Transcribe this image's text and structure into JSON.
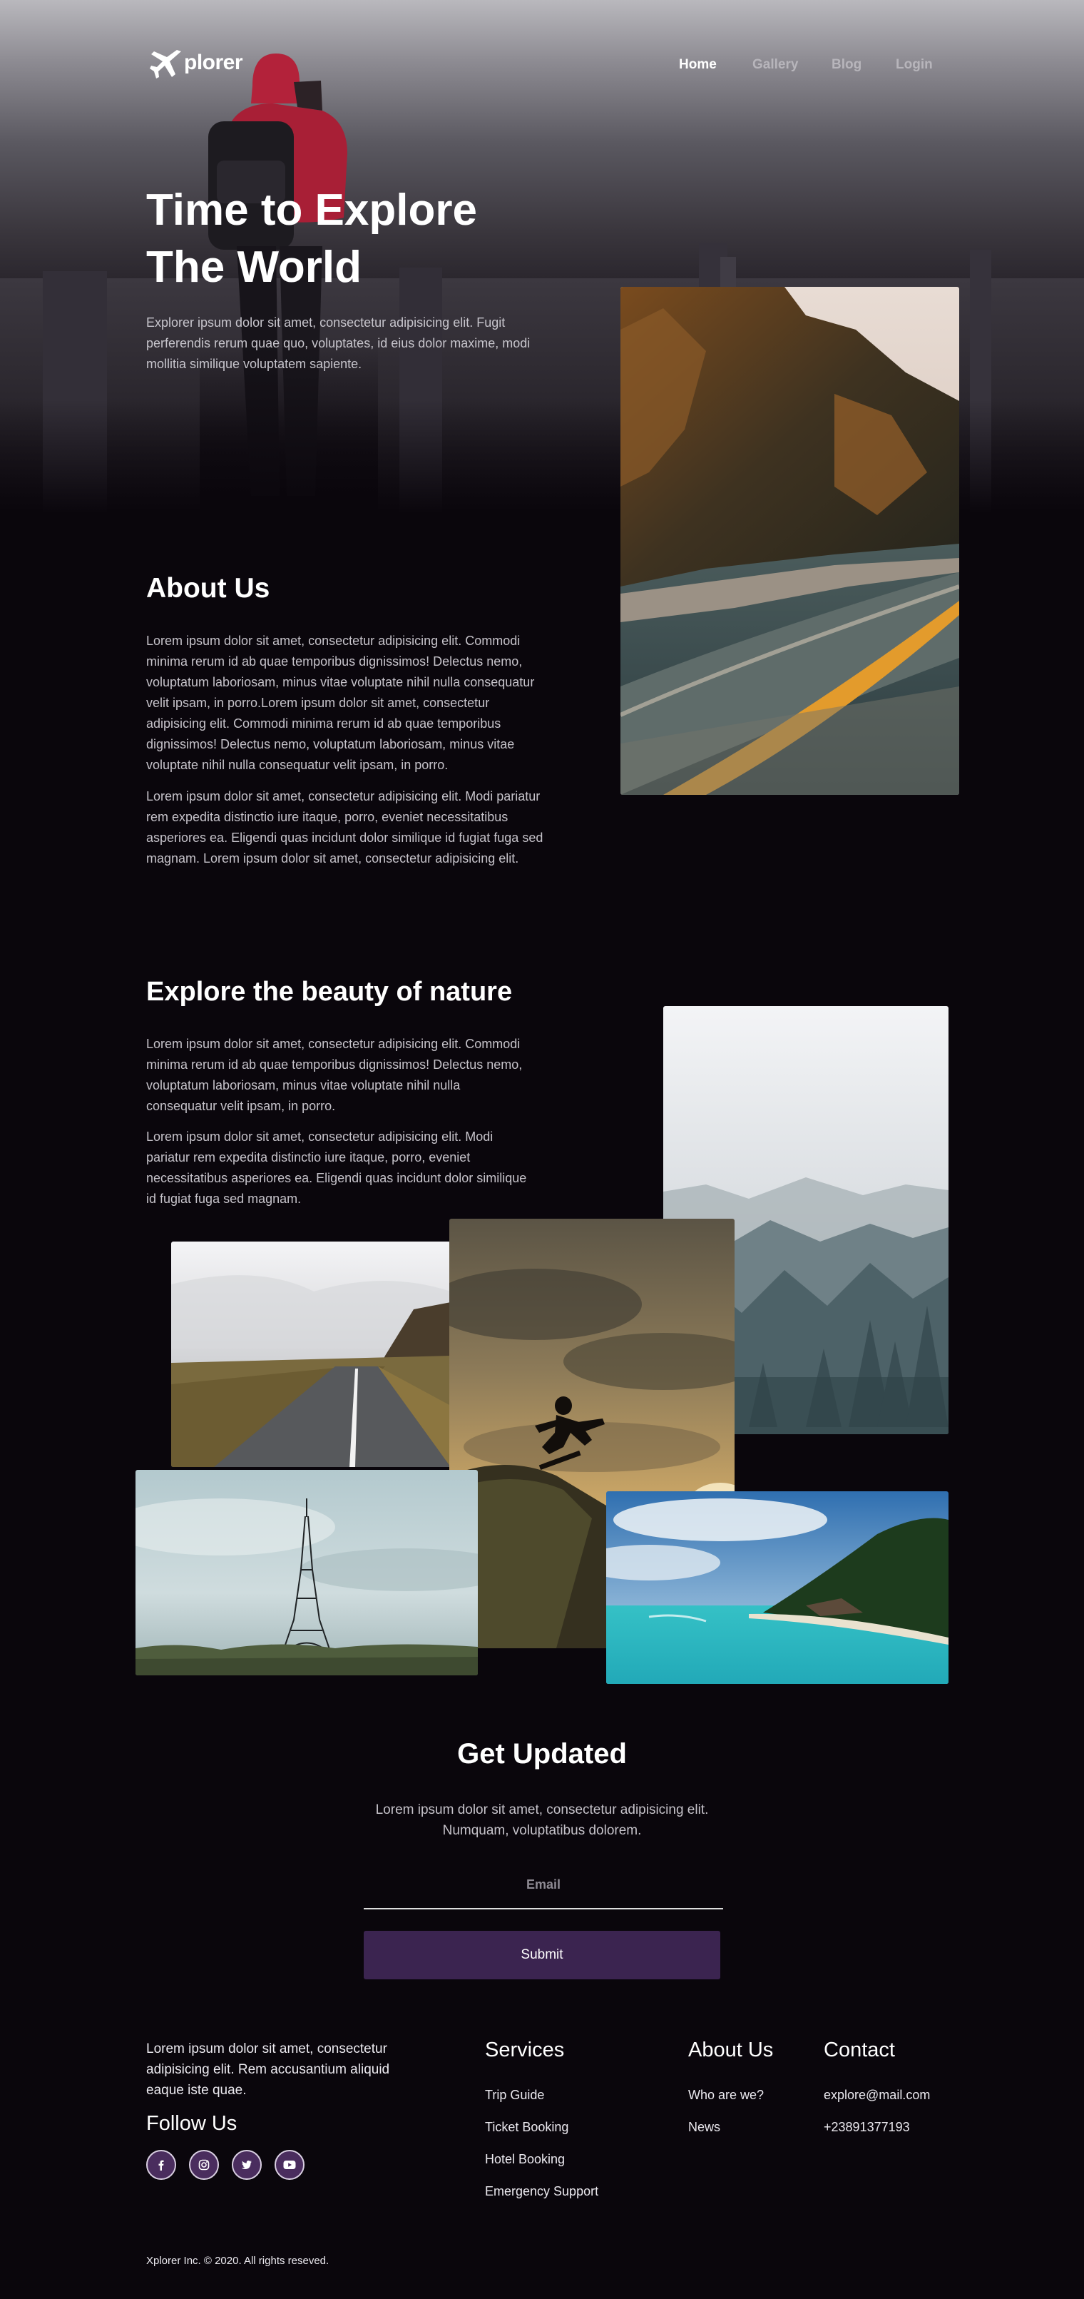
{
  "nav": {
    "logo_text": "plorer",
    "items": [
      {
        "label": "Home",
        "active": true
      },
      {
        "label": "Gallery",
        "active": false
      },
      {
        "label": "Blog",
        "active": false
      },
      {
        "label": "Login",
        "active": false
      }
    ]
  },
  "hero": {
    "title_line1": "Time to Explore",
    "title_line2": "The World",
    "text": "Explorer ipsum dolor sit amet, consectetur adipisicing elit. Fugit perferendis rerum quae quo, voluptates, id eius dolor maxime, modi mollitia similique voluptatem sapiente."
  },
  "about": {
    "title": "About Us",
    "para1": "Lorem ipsum dolor sit amet, consectetur adipisicing elit. Commodi minima rerum id ab quae temporibus dignissimos! Delectus nemo, voluptatum laboriosam, minus vitae voluptate nihil nulla consequatur velit ipsam, in porro.Lorem ipsum dolor sit amet, consectetur adipisicing elit. Commodi minima rerum id ab quae temporibus dignissimos! Delectus nemo, voluptatum laboriosam, minus vitae voluptate nihil nulla consequatur velit ipsam, in porro.",
    "para2": "Lorem ipsum dolor sit amet, consectetur adipisicing elit. Modi pariatur rem expedita distinctio iure itaque, porro, eveniet necessitatibus asperiores ea. Eligendi quas incidunt dolor similique id fugiat fuga sed magnam. Lorem ipsum dolor sit amet, consectetur adipisicing elit."
  },
  "nature": {
    "title": "Explore the beauty of nature",
    "para1": "Lorem ipsum dolor sit amet, consectetur adipisicing elit. Commodi minima rerum id ab quae temporibus dignissimos! Delectus nemo, voluptatum laboriosam, minus vitae voluptate nihil nulla consequatur velit ipsam, in porro.",
    "para2": "Lorem ipsum dolor sit amet, consectetur adipisicing elit. Modi pariatur rem expedita distinctio iure itaque, porro, eveniet necessitatibus asperiores ea. Eligendi quas incidunt dolor similique id fugiat fuga sed magnam."
  },
  "updates": {
    "title": "Get Updated",
    "text_line1": "Lorem ipsum dolor sit amet, consectetur adipisicing elit.",
    "text_line2": "Numquam, voluptatibus dolorem.",
    "email_placeholder": "Email",
    "submit_label": "Submit"
  },
  "footer": {
    "about_text": "Lorem ipsum dolor sit amet, consectetur adipisicing elit. Rem accusantium aliquid eaque iste quae.",
    "follow_title": "Follow Us",
    "social": [
      "facebook-icon",
      "instagram-icon",
      "twitter-icon",
      "youtube-icon"
    ],
    "services_title": "Services",
    "services": [
      "Trip Guide",
      "Ticket Booking",
      "Hotel Booking",
      "Emergency Support"
    ],
    "about_title": "About Us",
    "about_links": [
      "Who are we?",
      "News"
    ],
    "contact_title": "Contact",
    "contact": [
      "explore@mail.com",
      "+23891377193"
    ],
    "copyright": "Xplorer Inc. © 2020. All rights reseved."
  },
  "colors": {
    "background": "#0a060c",
    "accent": "#3b2450",
    "hiker_jacket": "#c0263a"
  }
}
